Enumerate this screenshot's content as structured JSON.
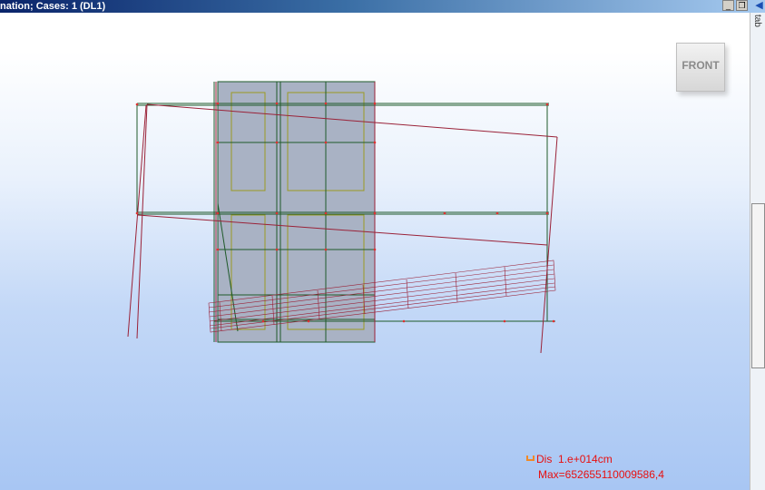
{
  "window": {
    "title": "nation; Cases: 1 (DL1)",
    "minimize_glyph": "_",
    "restore_glyph": "❐",
    "arrow_glyph": "◀"
  },
  "viewcube": {
    "label": "FRONT"
  },
  "legend": {
    "label": "Dis",
    "scale": "1.e+014cm",
    "max": "Max=652655110009586,4"
  },
  "side_panel": {
    "partial_text": "tab"
  },
  "colors": {
    "frame_green": "#1f5a2a",
    "deformed_red": "#9a2238",
    "panel_fill": "#a9b2c4",
    "opening_olive": "#9a9a22",
    "legend_red": "#e81010",
    "title_blue": "#0a246a"
  }
}
